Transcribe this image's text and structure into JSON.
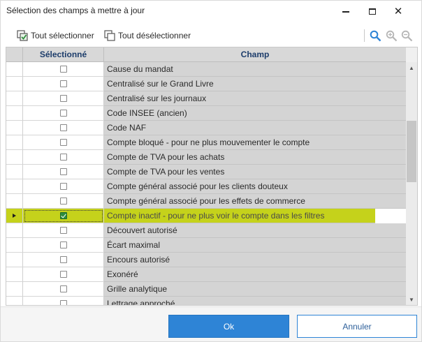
{
  "window": {
    "title": "Sélection des champs à mettre à jour"
  },
  "toolbar": {
    "select_all_label": "Tout sélectionner",
    "deselect_all_label": "Tout désélectionner",
    "icons": [
      "select-all-icon",
      "deselect-all-icon",
      "search-icon",
      "zoom-in-icon",
      "zoom-out-icon"
    ]
  },
  "grid": {
    "columns": [
      "Sélectionné",
      "Champ"
    ],
    "rows": [
      {
        "champ": "Cause du mandat",
        "selected": false
      },
      {
        "champ": "Centralisé sur le Grand Livre",
        "selected": false
      },
      {
        "champ": "Centralisé sur les journaux",
        "selected": false
      },
      {
        "champ": "Code INSEE (ancien)",
        "selected": false
      },
      {
        "champ": "Code NAF",
        "selected": false
      },
      {
        "champ": "Compte bloqué - pour ne plus mouvementer le compte",
        "selected": false
      },
      {
        "champ": "Compte de TVA pour les achats",
        "selected": false
      },
      {
        "champ": "Compte de TVA pour les ventes",
        "selected": false
      },
      {
        "champ": "Compte général associé pour les clients douteux",
        "selected": false
      },
      {
        "champ": "Compte général associé pour les effets de commerce",
        "selected": false
      },
      {
        "champ": "Compte inactif - pour ne plus voir le compte dans les filtres",
        "selected": true,
        "current": true
      },
      {
        "champ": "Découvert autorisé",
        "selected": false
      },
      {
        "champ": "Écart maximal",
        "selected": false
      },
      {
        "champ": "Encours autorisé",
        "selected": false
      },
      {
        "champ": "Exonéré",
        "selected": false
      },
      {
        "champ": "Grille analytique",
        "selected": false
      },
      {
        "champ": "Lettrage approché",
        "selected": false
      }
    ]
  },
  "footer": {
    "ok_label": "Ok",
    "cancel_label": "Annuler"
  },
  "colors": {
    "accent_blue": "#2e84d6",
    "current_row_highlight": "#c5d21b",
    "checkbox_checked": "#2f8d3d",
    "header_text": "#1d3d6b"
  }
}
